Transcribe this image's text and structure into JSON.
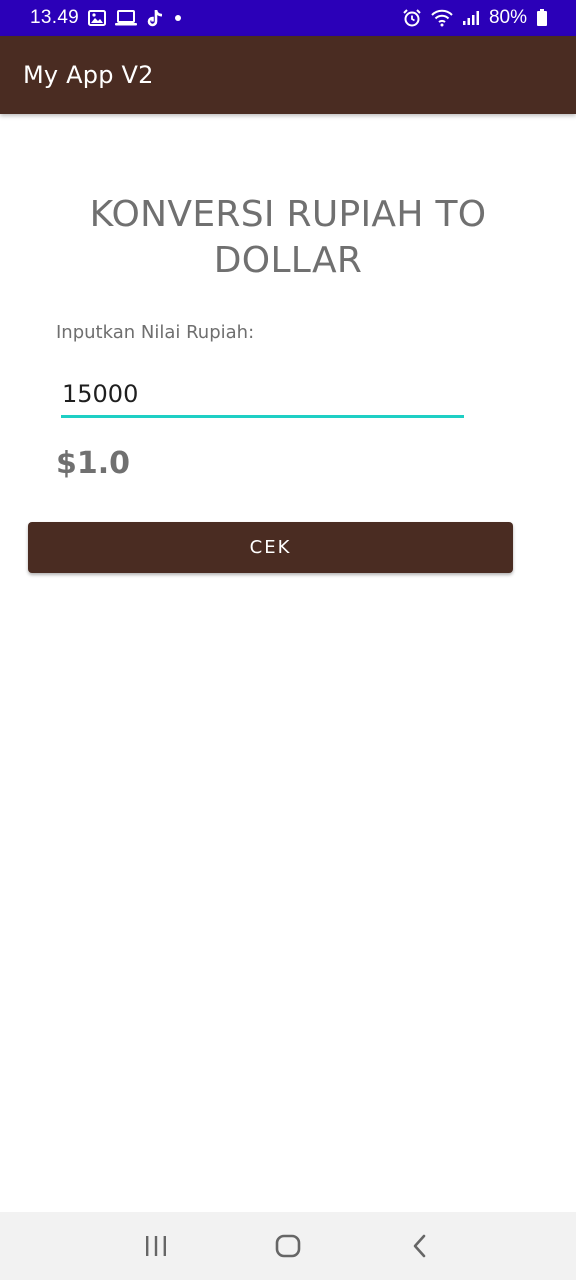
{
  "status_bar": {
    "time": "13.49",
    "battery": "80%",
    "icons": [
      "image-icon",
      "laptop-icon",
      "tiktok-icon",
      "dot-icon",
      "alarm-icon",
      "wifi-icon",
      "signal-icon",
      "battery-icon"
    ]
  },
  "app_bar": {
    "title": "My App V2"
  },
  "main": {
    "heading": "KONVERSI RUPIAH TO DOLLAR",
    "input_label": "Inputkan Nilai Rupiah:",
    "input_value": "15000",
    "result": "$1.0",
    "button_label": "CEK"
  },
  "nav_bar": {
    "icons": [
      "recent-apps-icon",
      "home-icon",
      "back-icon"
    ]
  },
  "colors": {
    "status_bar": "#2b00b8",
    "app_bar": "#4a2c22",
    "button": "#4a2c22",
    "input_underline": "#1ecfc4",
    "heading_text": "#707070"
  }
}
